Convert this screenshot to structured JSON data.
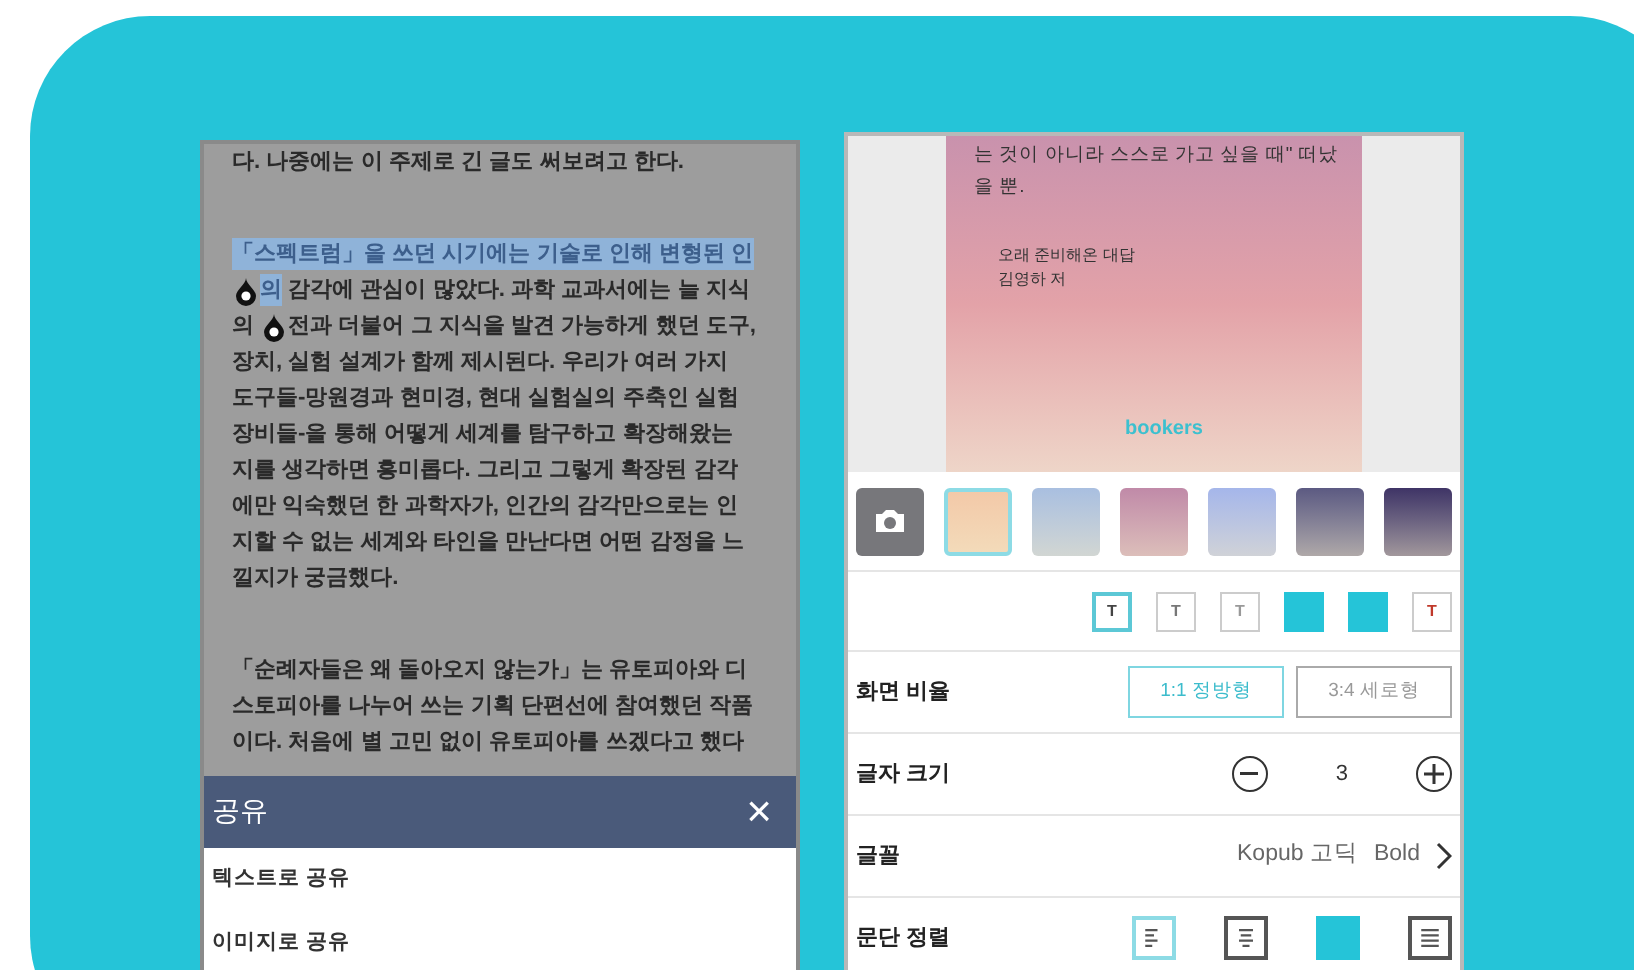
{
  "reader": {
    "paragraphs": [
      [
        [
          {
            "kind": "text",
            "text": "다. 나중에는 이 주제로 긴 글도 써보려고 한다.",
            "highlighted": false
          }
        ]
      ],
      [
        [
          {
            "kind": "text",
            "text": "「스펙트럼」을 쓰던 시기에는 기술로 인해 변형된 인",
            "highlighted": true
          }
        ],
        [
          {
            "kind": "handle"
          },
          {
            "kind": "text",
            "text": "의",
            "highlighted": true
          },
          {
            "kind": "text",
            "text": " 감각에 관심이 많았다. 과학 교과서에는 늘 지식",
            "highlighted": false
          }
        ],
        [
          {
            "kind": "text",
            "text": "의 ",
            "highlighted": false
          },
          {
            "kind": "handle"
          },
          {
            "kind": "text",
            "text": "전과 더불어 그 지식을 발견 가능하게 했던 도구,",
            "highlighted": false
          }
        ],
        [
          {
            "kind": "text",
            "text": "장치, 실험 설계가 함께 제시된다. 우리가 여러 가지",
            "highlighted": false
          }
        ],
        [
          {
            "kind": "text",
            "text": "도구들-망원경과 현미경, 현대 실험실의 주축인 실험",
            "highlighted": false
          }
        ],
        [
          {
            "kind": "text",
            "text": "장비들-을 통해 어떻게 세계를 탐구하고 확장해왔는",
            "highlighted": false
          }
        ],
        [
          {
            "kind": "text",
            "text": "지를 생각하면 흥미롭다. 그리고 그렇게 확장된 감각",
            "highlighted": false
          }
        ],
        [
          {
            "kind": "text",
            "text": "에만 익숙했던 한 과학자가, 인간의 감각만으로는 인",
            "highlighted": false
          }
        ],
        [
          {
            "kind": "text",
            "text": "지할 수 없는 세계와 타인을 만난다면 어떤 감정을 느",
            "highlighted": false
          }
        ],
        [
          {
            "kind": "text",
            "text": "낄지가 궁금했다.",
            "highlighted": false
          }
        ]
      ],
      [
        [
          {
            "kind": "text",
            "text": "「순례자들은 왜 돌아오지 않는가」는 유토피아와 디",
            "highlighted": false
          }
        ],
        [
          {
            "kind": "text",
            "text": "스토피아를 나누어 쓰는 기획 단편선에 참여했던 작품",
            "highlighted": false
          }
        ],
        [
          {
            "kind": "text",
            "text": "이다. 처음에 별 고민 없이 유토피아를 쓰겠다고 했다",
            "highlighted": false
          }
        ]
      ]
    ],
    "share_sheet": {
      "title": "공유",
      "close": "×",
      "options": [
        "텍스트로 공유",
        "이미지로 공유"
      ]
    }
  },
  "editor": {
    "card": {
      "quote_lines": [
        "는 것이 아니라 스스로 가고 싶을 때\" 떠났",
        "을 뿐."
      ],
      "book_title": "오래 준비해온 대답",
      "author": "김영하 저",
      "brand": "bookers"
    },
    "backgrounds": [
      {
        "kind": "camera",
        "selected": false
      },
      {
        "kind": "gradient",
        "color": "#f3c9a8",
        "selected": true
      },
      {
        "kind": "gradient",
        "color": "#a9bfe0",
        "selected": false
      },
      {
        "kind": "gradient",
        "color": "#c08aa8",
        "selected": false
      },
      {
        "kind": "gradient",
        "color": "#a5b6ea",
        "selected": false
      },
      {
        "kind": "gradient",
        "color": "#5c5a82",
        "selected": false
      },
      {
        "kind": "gradient",
        "color": "#3f3466",
        "selected": false
      }
    ],
    "text_styles": [
      {
        "kind": "letter",
        "label": "T",
        "color": "#444444",
        "selected": true
      },
      {
        "kind": "letter",
        "label": "T",
        "color": "#777777",
        "selected": false
      },
      {
        "kind": "letter",
        "label": "T",
        "color": "#999999",
        "selected": false
      },
      {
        "kind": "fill",
        "selected": false
      },
      {
        "kind": "fill",
        "selected": false
      },
      {
        "kind": "letter",
        "label": "T",
        "color": "#c0392b",
        "selected": false
      }
    ],
    "settings": [
      {
        "kind": "ratio",
        "label": "화면 비율",
        "options": [
          {
            "label": "1:1 정방형",
            "selected": true
          },
          {
            "label": "3:4 세로형",
            "selected": false
          }
        ]
      },
      {
        "kind": "size",
        "label": "글자 크기",
        "value": "3"
      },
      {
        "kind": "font",
        "label": "글꼴",
        "font": "Kopub 고딕",
        "weight": "Bold"
      },
      {
        "kind": "align",
        "label": "문단 정렬",
        "options": [
          {
            "kind": "left",
            "selected": true
          },
          {
            "kind": "center",
            "selected": false
          },
          {
            "kind": "fill",
            "selected": false
          },
          {
            "kind": "justify",
            "selected": false
          }
        ]
      }
    ]
  }
}
